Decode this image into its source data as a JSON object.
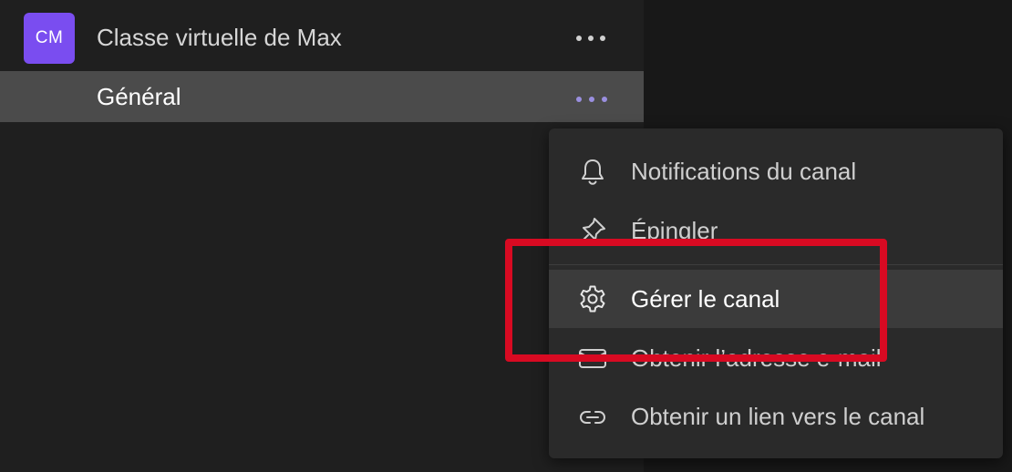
{
  "team": {
    "avatar_initials": "CM",
    "name": "Classe virtuelle de Max",
    "more_icon": "more-horizontal-icon"
  },
  "channel": {
    "name": "Général",
    "more_icon": "more-horizontal-icon"
  },
  "context_menu": {
    "items": [
      {
        "label": "Notifications du canal",
        "icon": "bell-icon"
      },
      {
        "label": "Épingler",
        "icon": "pin-icon"
      },
      {
        "label": "Gérer le canal",
        "icon": "gear-icon"
      },
      {
        "label": "Obtenir l’adresse e-mail",
        "icon": "mail-icon"
      },
      {
        "label": "Obtenir un lien vers le canal",
        "icon": "link-icon"
      }
    ],
    "highlighted_item": "Gérer le canal"
  },
  "colors": {
    "avatar": "#7a4df0",
    "selected_channel_bg": "#4b4b4b",
    "highlight_border": "#d80a22",
    "channel_dots": "#9a8fe0"
  }
}
